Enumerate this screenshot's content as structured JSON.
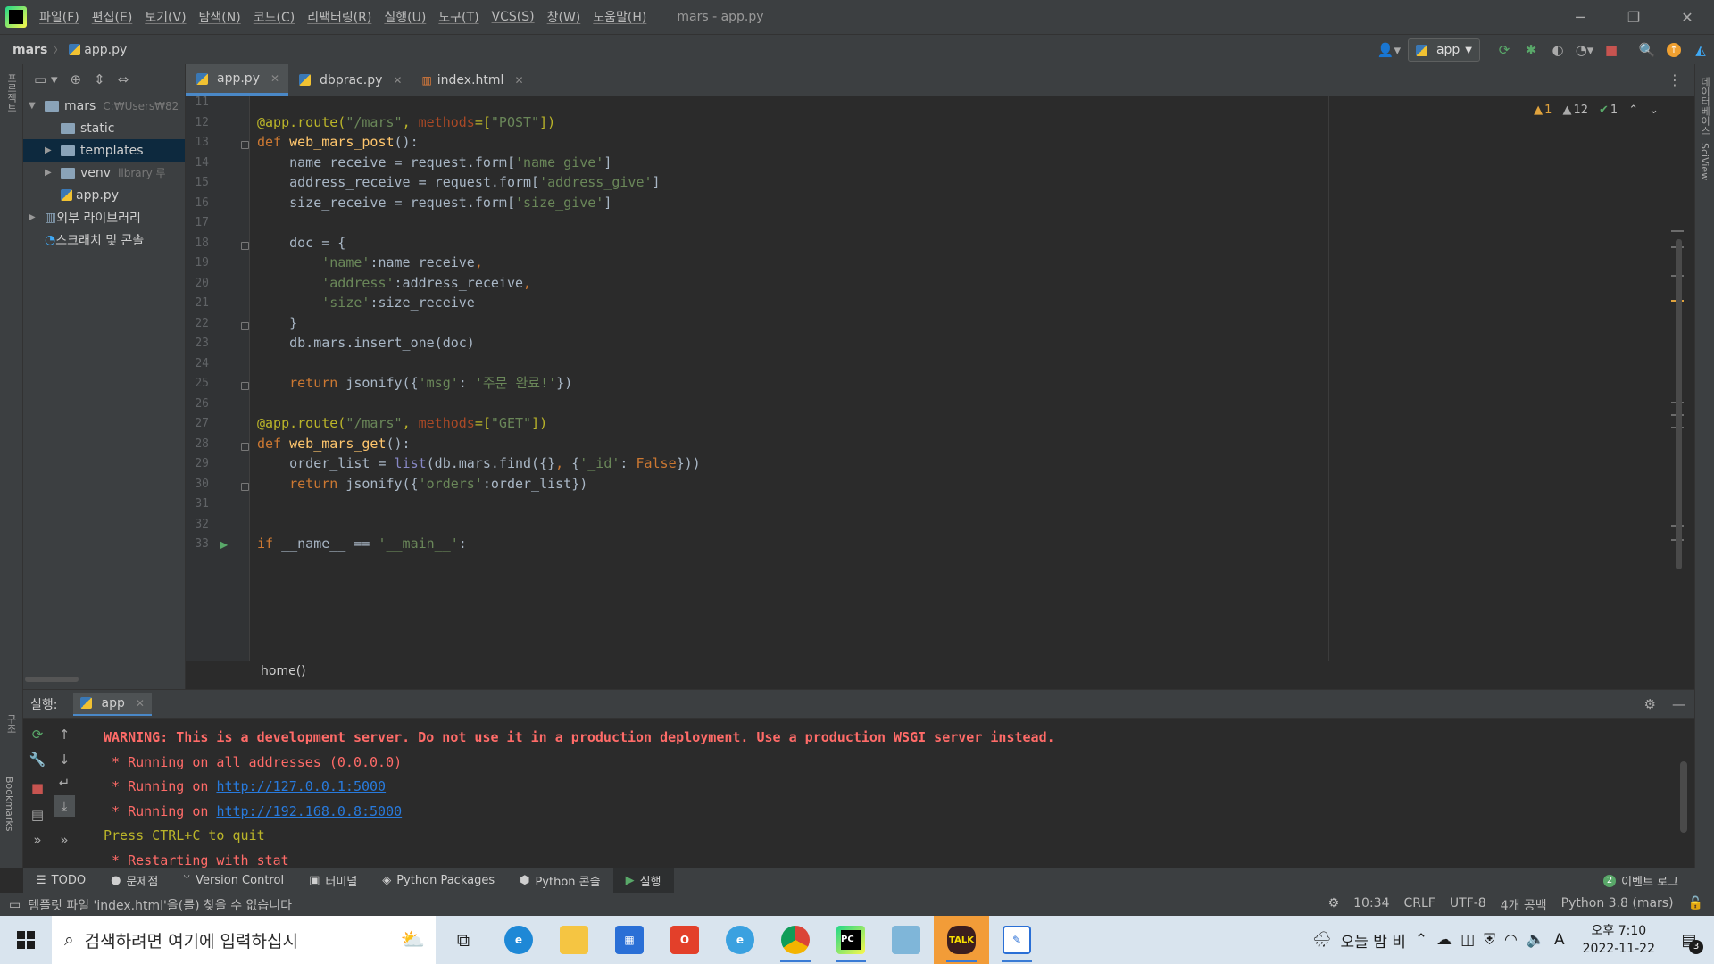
{
  "menubar": {
    "items": [
      "파일(F)",
      "편집(E)",
      "보기(V)",
      "탐색(N)",
      "코드(C)",
      "리팩터링(R)",
      "실행(U)",
      "도구(T)",
      "VCS(S)",
      "창(W)",
      "도움말(H)"
    ],
    "title": "mars - app.py"
  },
  "navbar": {
    "project": "mars",
    "file": "app.py",
    "run_config": "app"
  },
  "left_strip": {
    "project_label": "프로젝트",
    "structure_label": "구조",
    "bookmarks_label": "Bookmarks"
  },
  "right_strip": {
    "database_label": "데이터베이스",
    "sciview_label": "SciView"
  },
  "project_tree": [
    {
      "label": "mars",
      "hint": "C:₩Users₩82",
      "level": 0,
      "expanded": true,
      "type": "folder"
    },
    {
      "label": "static",
      "hint": "",
      "level": 1,
      "expanded": false,
      "type": "folder"
    },
    {
      "label": "templates",
      "hint": "",
      "level": 1,
      "expanded": false,
      "type": "folder"
    },
    {
      "label": "venv",
      "hint": "library 루",
      "level": 1,
      "expanded": false,
      "type": "folder"
    },
    {
      "label": "app.py",
      "hint": "",
      "level": 1,
      "expanded": false,
      "type": "pyfile"
    },
    {
      "label": "외부 라이브러리",
      "hint": "",
      "level": 0,
      "expanded": false,
      "type": "library"
    },
    {
      "label": "스크래치 및 콘솔",
      "hint": "",
      "level": 0,
      "expanded": false,
      "type": "scratch"
    }
  ],
  "tabs": [
    {
      "label": "app.py",
      "active": true
    },
    {
      "label": "dbprac.py",
      "active": false
    },
    {
      "label": "index.html",
      "active": false
    }
  ],
  "inspections": {
    "warnings": "1",
    "weak_warnings": "12",
    "typos": "1"
  },
  "code_lines": [
    {
      "no": "11",
      "html": ""
    },
    {
      "no": "12",
      "html": "<span class=\"dec\">@app.route(</span><span class=\"str\">\"/mars\"</span><span class=\"dec\">, </span><span class=\"param\">methods</span><span class=\"dec\">=[</span><span class=\"str\">\"POST\"</span><span class=\"dec\">])</span>"
    },
    {
      "no": "13",
      "html": "<span class=\"kw\">def </span><span class=\"fn\">web_mars_post</span>():"
    },
    {
      "no": "14",
      "html": "    name_receive = request.form[<span class=\"str\">'name_give'</span>]"
    },
    {
      "no": "15",
      "html": "    address_receive = request.form[<span class=\"str\">'address_give'</span>]"
    },
    {
      "no": "16",
      "html": "    size_receive = request.form[<span class=\"str\">'size_give'</span>]"
    },
    {
      "no": "17",
      "html": ""
    },
    {
      "no": "18",
      "html": "    doc = {"
    },
    {
      "no": "19",
      "html": "        <span class=\"str\">'name'</span>:name_receive<span class=\"kw\">,</span>"
    },
    {
      "no": "20",
      "html": "        <span class=\"str\">'address'</span>:address_receive<span class=\"kw\">,</span>"
    },
    {
      "no": "21",
      "html": "        <span class=\"str\">'size'</span>:size_receive"
    },
    {
      "no": "22",
      "html": "    }"
    },
    {
      "no": "23",
      "html": "    db.mars.insert_one(doc)"
    },
    {
      "no": "24",
      "html": ""
    },
    {
      "no": "25",
      "html": "    <span class=\"kw\">return </span>jsonify({<span class=\"str\">'msg'</span>: <span class=\"str\">'주문 완료!'</span>})"
    },
    {
      "no": "26",
      "html": ""
    },
    {
      "no": "27",
      "html": "<span class=\"dec\">@app.route(</span><span class=\"str\">\"/mars\"</span><span class=\"dec\">, </span><span class=\"param\">methods</span><span class=\"dec\">=[</span><span class=\"str\">\"GET\"</span><span class=\"dec\">])</span>"
    },
    {
      "no": "28",
      "html": "<span class=\"kw\">def </span><span class=\"fn\">web_mars_get</span>():"
    },
    {
      "no": "29",
      "html": "    order_list = <span class=\"builtin\">list</span>(db.mars.find({}<span class=\"kw\">, </span>{<span class=\"str\">'_id'</span>: <span class=\"kw\">False</span>}))"
    },
    {
      "no": "30",
      "html": "    <span class=\"kw\">return </span>jsonify({<span class=\"str\">'orders'</span>:order_list})"
    },
    {
      "no": "31",
      "html": ""
    },
    {
      "no": "32",
      "html": ""
    },
    {
      "no": "33",
      "html": "<span class=\"kw\">if </span>__name__ == <span class=\"str\">'__main__'</span>:"
    }
  ],
  "code_breadcrumb": "home()",
  "run_panel": {
    "label": "실행:",
    "tab": "app",
    "console": [
      {
        "text": "WARNING: This is a development server. Do not use it in a production deployment. Use a production WSGI server instead.",
        "kind": "warn"
      },
      {
        "text": " * Running on all addresses (0.0.0.0)",
        "kind": "err"
      },
      {
        "text": " * Running on ",
        "link": "http://127.0.0.1:5000",
        "kind": "err"
      },
      {
        "text": " * Running on ",
        "link": "http://192.168.0.8:5000",
        "kind": "err"
      },
      {
        "text": "Press CTRL+C to quit",
        "kind": "plain"
      },
      {
        "text": " * Restarting with stat",
        "kind": "err"
      }
    ]
  },
  "tool_windows": [
    "TODO",
    "문제점",
    "Version Control",
    "터미널",
    "Python Packages",
    "Python 콘솔",
    "실행"
  ],
  "event_log": {
    "count": "2",
    "label": "이벤트 로그"
  },
  "status": {
    "message": "템플릿 파일 'index.html'을(를) 찾을 수 없습니다",
    "position": "10:34",
    "line_sep": "CRLF",
    "encoding": "UTF-8",
    "indent": "4개 공백",
    "interpreter": "Python 3.8 (mars)"
  },
  "taskbar": {
    "search_placeholder": "검색하려면 여기에 입력하십시",
    "weather": "오늘 밤 비",
    "ime": "A",
    "time": "오후 7:10",
    "date": "2022-11-22",
    "notifications": "3"
  },
  "colors": {
    "accent": "#4a88c7",
    "editor_bg": "#2b2b2b",
    "panel_bg": "#3c3f41",
    "error_text": "#ff6b68",
    "link": "#287bde"
  }
}
